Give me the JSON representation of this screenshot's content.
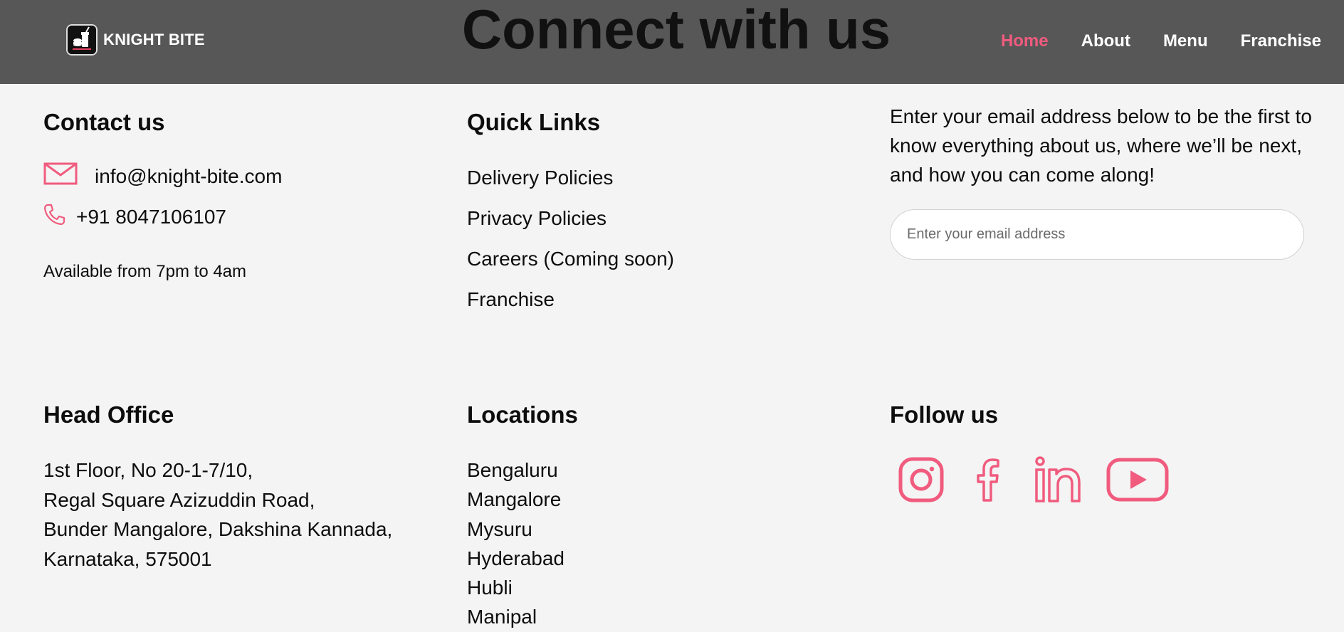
{
  "header": {
    "brand": "KNIGHT BITE",
    "hero_title": "Connect with us",
    "nav": [
      {
        "label": "Home",
        "active": true
      },
      {
        "label": "About",
        "active": false
      },
      {
        "label": "Menu",
        "active": false
      },
      {
        "label": "Franchise",
        "active": false
      }
    ]
  },
  "contact": {
    "heading": "Contact us",
    "email": "info@knight-bite.com",
    "phone": "+91 8047106107",
    "availability": "Available from 7pm to 4am"
  },
  "quick_links": {
    "heading": "Quick Links",
    "items": [
      "Delivery Policies",
      "Privacy Policies",
      "Careers (Coming soon)",
      "Franchise"
    ]
  },
  "newsletter": {
    "text": "Enter your email address below to be the first to know everything about us, where we’ll be next, and how you can come along!",
    "placeholder": "Enter your email address"
  },
  "head_office": {
    "heading": "Head Office",
    "lines": [
      "1st Floor, No 20-1-7/10,",
      "Regal Square Azizuddin Road,",
      "Bunder Mangalore, Dakshina Kannada,",
      "Karnataka, 575001"
    ]
  },
  "locations": {
    "heading": "Locations",
    "items": [
      "Bengaluru",
      "Mangalore",
      "Mysuru",
      "Hyderabad",
      "Hubli",
      "Manipal"
    ]
  },
  "follow": {
    "heading": "Follow us",
    "icons": [
      "instagram-icon",
      "facebook-icon",
      "linkedin-icon",
      "youtube-icon"
    ]
  },
  "colors": {
    "accent": "#f05b7e",
    "header_bg": "#585758",
    "page_bg": "#f4f4f4"
  }
}
